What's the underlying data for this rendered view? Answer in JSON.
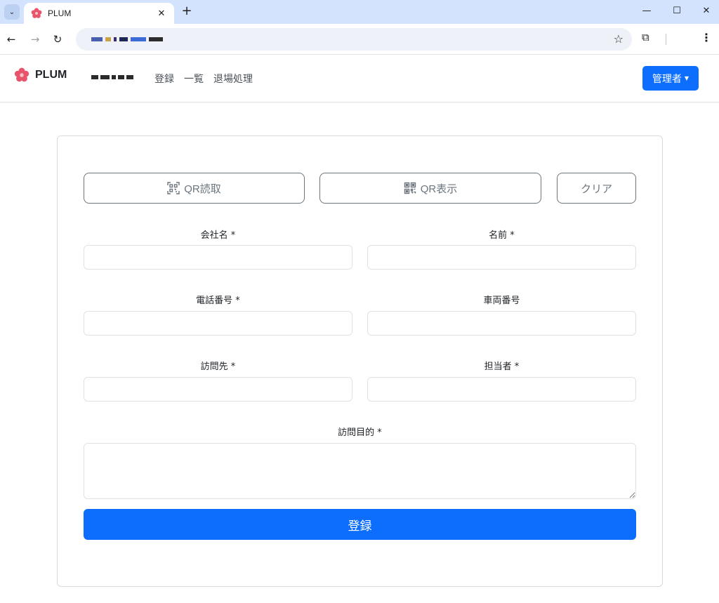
{
  "browser": {
    "tab_title": "PLUM",
    "tab_close": "✕",
    "new_tab": "+",
    "minimize": "—",
    "maximize": "☐",
    "close": "✕"
  },
  "navbar": {
    "brand": "PLUM",
    "links": [
      "登録",
      "一覧",
      "退場処理"
    ],
    "admin_label": "管理者",
    "brand_color": "#e8546b",
    "accent": "#0d6efd"
  },
  "form": {
    "buttons": {
      "qr_read": "QR読取",
      "qr_show": "QR表示",
      "clear": "クリア"
    },
    "fields": {
      "company": {
        "label": "会社名 *",
        "value": ""
      },
      "name": {
        "label": "名前 *",
        "value": ""
      },
      "phone": {
        "label": "電話番号 *",
        "value": ""
      },
      "vehicle": {
        "label": "車両番号",
        "value": ""
      },
      "destination": {
        "label": "訪問先 *",
        "value": ""
      },
      "contact": {
        "label": "担当者 *",
        "value": ""
      },
      "purpose": {
        "label": "訪問目的 *",
        "value": ""
      }
    },
    "submit_label": "登録"
  },
  "icons": {
    "qr_read": "qr-scan-icon",
    "qr_show": "qr-code-icon"
  }
}
